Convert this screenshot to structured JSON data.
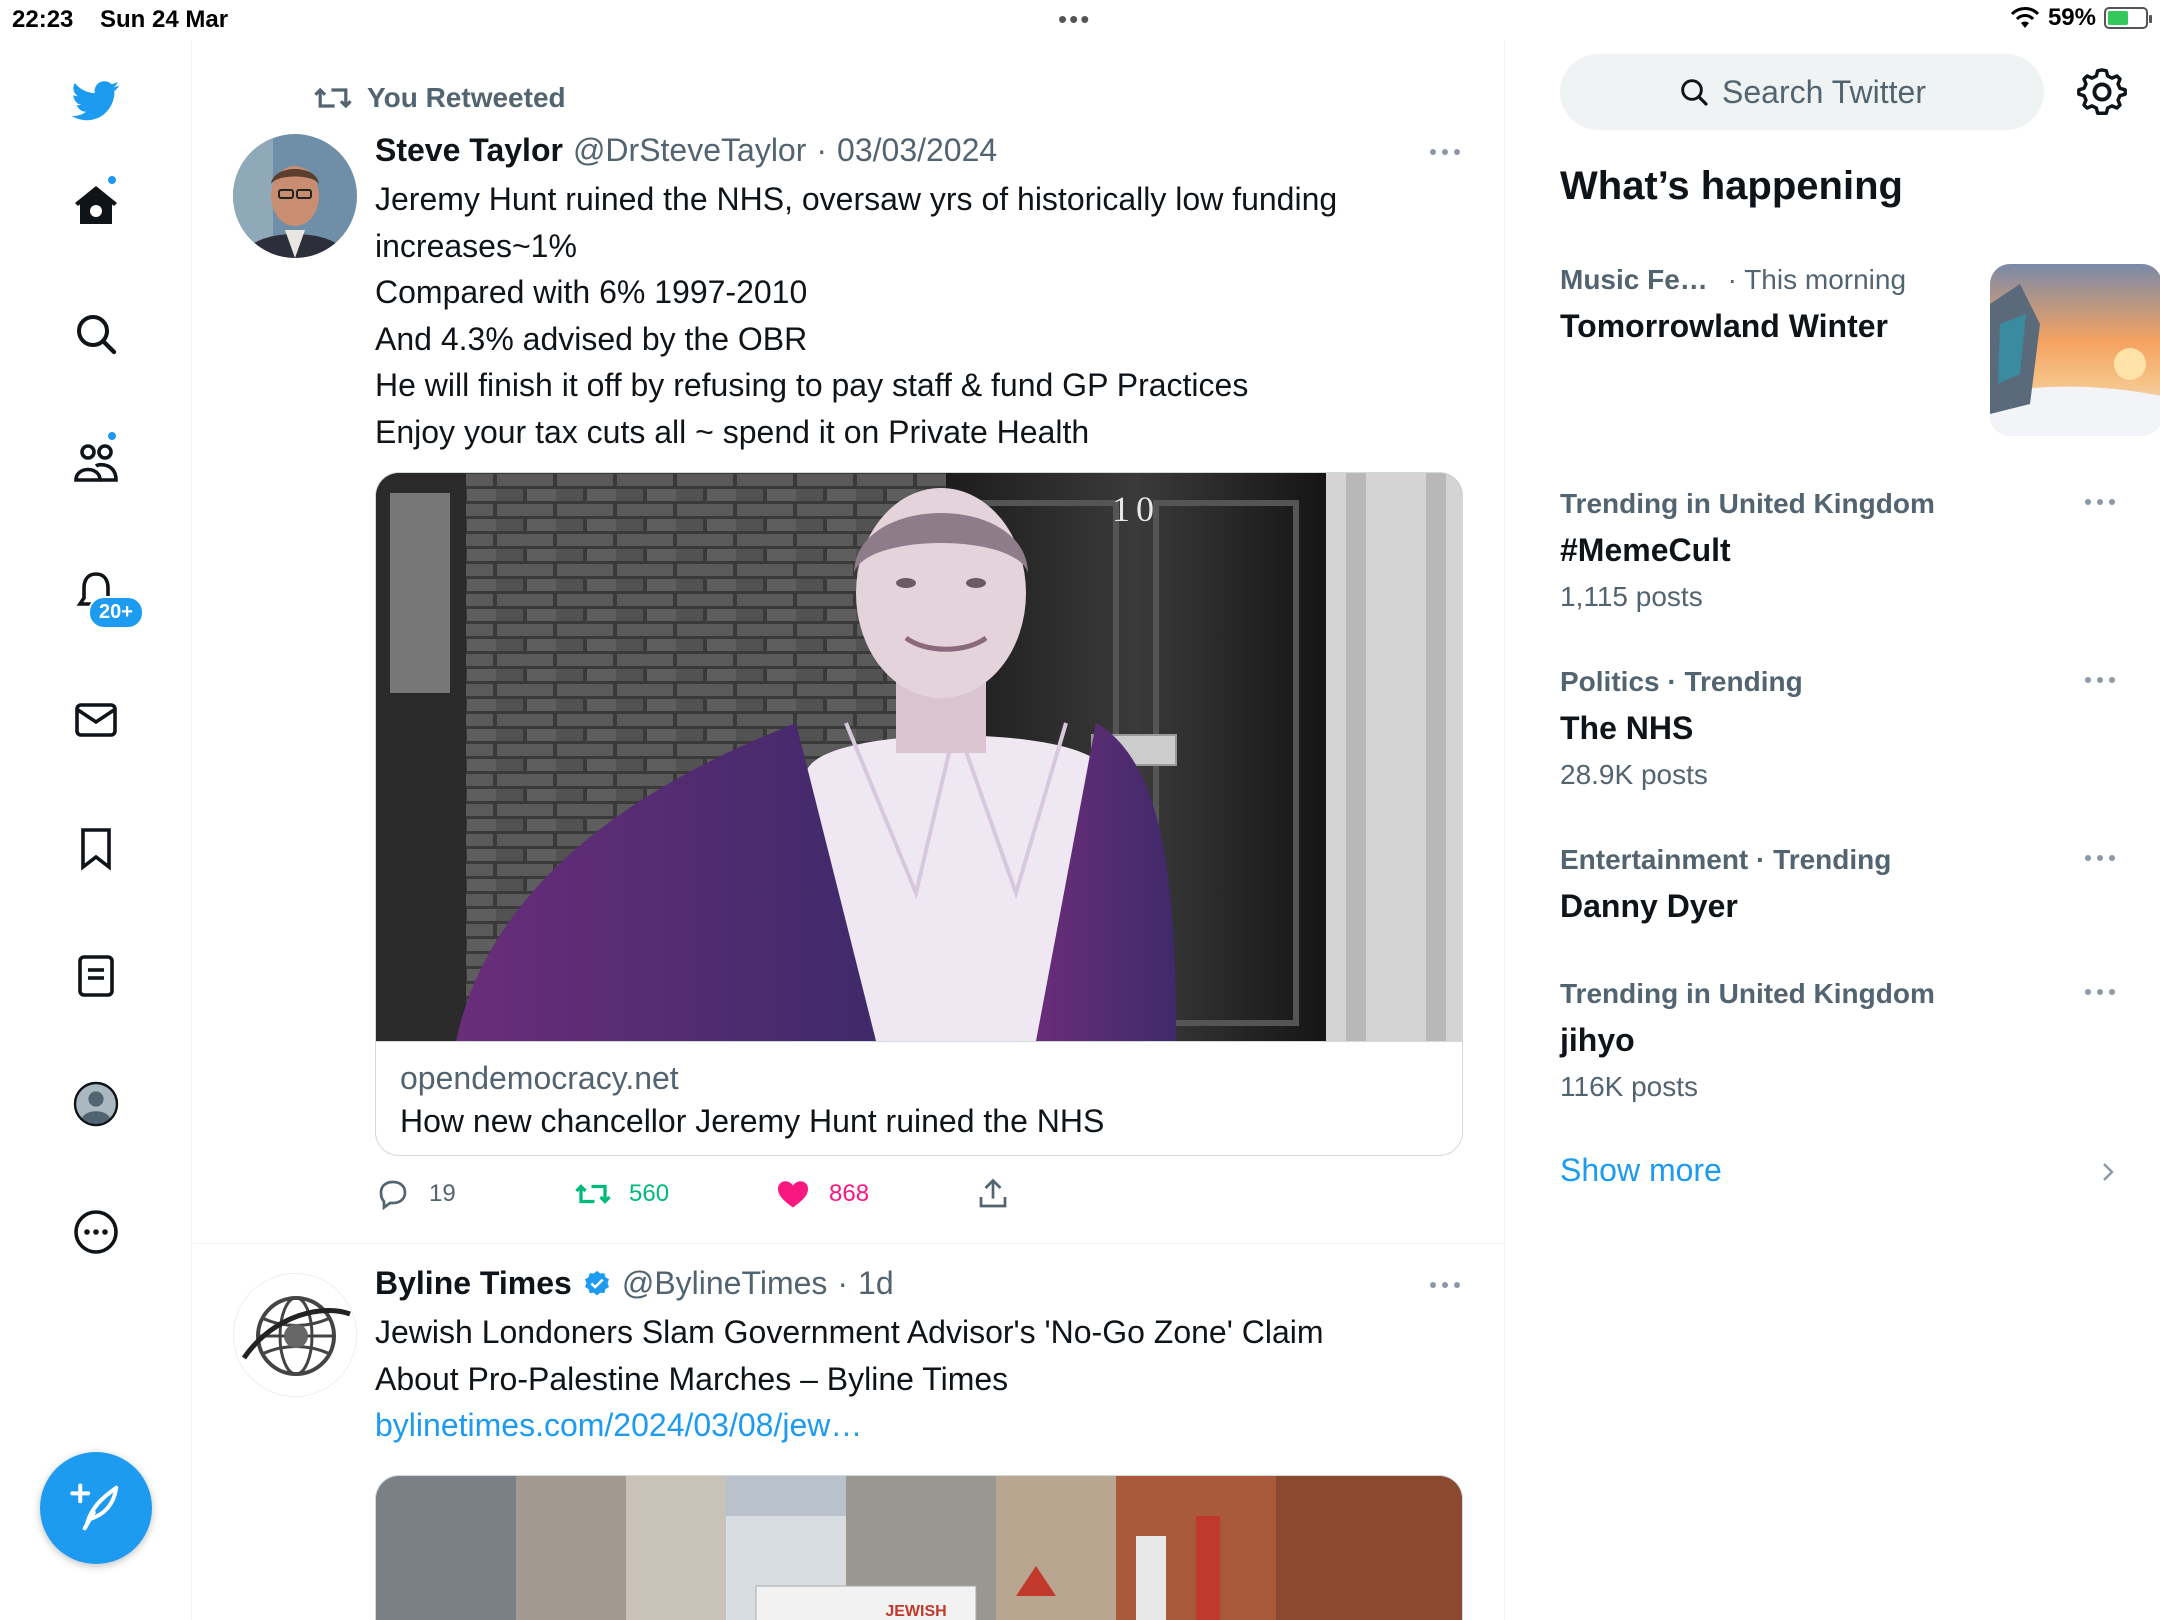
{
  "status_bar": {
    "time": "22:23",
    "date": "Sun 24 Mar",
    "battery": "59%",
    "battery_level": 0.59
  },
  "nav": {
    "notifications_badge": "20+",
    "accent": "#1d9bf0"
  },
  "timeline": {
    "tweets": [
      {
        "social_context": "You Retweeted",
        "author_name": "Steve Taylor",
        "handle": "@DrSteveTaylor",
        "separator": "·",
        "date": "03/03/2024",
        "text_lines": [
          "Jeremy Hunt ruined the NHS, oversaw yrs of historically low funding increases~1%",
          "Compared with 6% 1997-2010",
          "And 4.3% advised by the OBR",
          "He will finish it off by refusing to pay staff & fund GP Practices",
          "Enjoy your tax cuts all ~ spend it on Private Health"
        ],
        "card": {
          "door_number": "10",
          "domain": "opendemocracy.net",
          "title": "How new chancellor Jeremy Hunt ruined the NHS"
        },
        "actions": {
          "replies": "19",
          "retweets": "560",
          "likes": "868"
        }
      },
      {
        "author_name": "Byline Times",
        "handle": "@BylineTimes",
        "separator": "·",
        "date": "1d",
        "text": "Jewish Londoners Slam Government Advisor's 'No-Go Zone' Claim About Pro-Palestine Marches – Byline Times ",
        "link_text": "bylinetimes.com/2024/03/08/jew…",
        "banner_text": "JEWISH"
      }
    ]
  },
  "sidebar": {
    "search_placeholder": "Search Twitter",
    "section_title": "What’s happening",
    "featured": {
      "category": "Music Fe…",
      "time": "· This morning",
      "name": "Tomorrowland Winter"
    },
    "trends": [
      {
        "context": "Trending in United Kingdom",
        "name": "#MemeCult",
        "count": "1,115 posts"
      },
      {
        "context": "Politics · Trending",
        "name": "The NHS",
        "count": "28.9K posts"
      },
      {
        "context": "Entertainment · Trending",
        "name": "Danny Dyer",
        "count": ""
      },
      {
        "context": "Trending in United Kingdom",
        "name": "jihyo",
        "count": "116K posts"
      }
    ],
    "show_more": "Show more"
  }
}
